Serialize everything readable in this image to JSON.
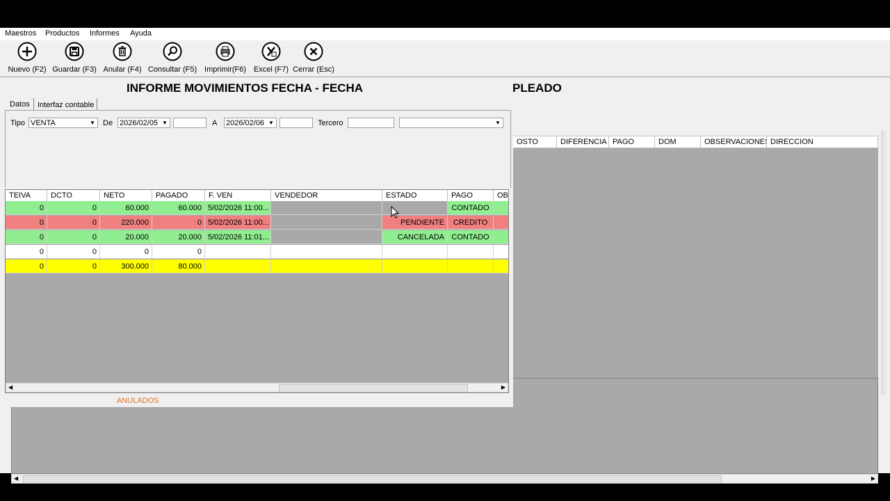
{
  "menu": {
    "items": [
      "Maestros",
      "Productos",
      "Informes",
      "Ayuda"
    ]
  },
  "toolbar": {
    "buttons": [
      {
        "label": "Nuevo (F2)",
        "icon": "plus-circle-icon"
      },
      {
        "label": "Guardar (F3)",
        "icon": "save-icon"
      },
      {
        "label": "Anular (F4)",
        "icon": "trash-icon"
      },
      {
        "label": "Consultar (F5)",
        "icon": "search-icon"
      },
      {
        "label": "Imprimir(F6)",
        "icon": "printer-icon"
      },
      {
        "label": "Excel (F7)",
        "icon": "excel-icon"
      },
      {
        "label": "Cerrar (Esc)",
        "icon": "close-icon"
      }
    ]
  },
  "report": {
    "title": "INFORME MOVIMIENTOS FECHA - FECHA",
    "back_title": "PLEADO",
    "tabs": [
      "Datos",
      "Interfaz contable"
    ],
    "filters": {
      "tipo_label": "Tipo",
      "tipo_value": "VENTA",
      "de_label": "De",
      "de_value": "2026/02/05",
      "a_label": "A",
      "a_value": "2026/02/06",
      "tercero_label": "Tercero"
    },
    "columns": [
      "TEIVA",
      "DCTO",
      "NETO",
      "PAGADO",
      "F. VEN",
      "VENDEDOR",
      "ESTADO",
      "PAGO",
      "OB"
    ],
    "rows": [
      {
        "teiva": "0",
        "dcto": "0",
        "neto": "60.000",
        "pagado": "60.000",
        "fven": "5/02/2026 11:00...",
        "vendedor": "",
        "estado": "",
        "pago": "CONTADO"
      },
      {
        "teiva": "0",
        "dcto": "0",
        "neto": "220.000",
        "pagado": "0",
        "fven": "5/02/2026 11:00...",
        "vendedor": "",
        "estado": "PENDIENTE",
        "pago": "CREDITO"
      },
      {
        "teiva": "0",
        "dcto": "0",
        "neto": "20.000",
        "pagado": "20.000",
        "fven": "5/02/2026 11:01...",
        "vendedor": "",
        "estado": "CANCELADA",
        "pago": "CONTADO"
      },
      {
        "teiva": "0",
        "dcto": "0",
        "neto": "0",
        "pagado": "0",
        "fven": "",
        "vendedor": "",
        "estado": "",
        "pago": ""
      },
      {
        "teiva": "0",
        "dcto": "0",
        "neto": "300.000",
        "pagado": "80.000",
        "fven": "",
        "vendedor": "",
        "estado": "",
        "pago": ""
      }
    ],
    "back_columns": [
      "OSTO",
      "DIFERENCIA",
      "PAGO",
      "DOM",
      "OBSERVACIONES",
      "DIRECCION"
    ],
    "anulados_label": "ANULADOS"
  },
  "colors": {
    "green": "#90ee90",
    "red": "#f08080",
    "yellow": "#ffff00",
    "grid_gray": "#a9a9a9",
    "anulados": "#e07020"
  }
}
